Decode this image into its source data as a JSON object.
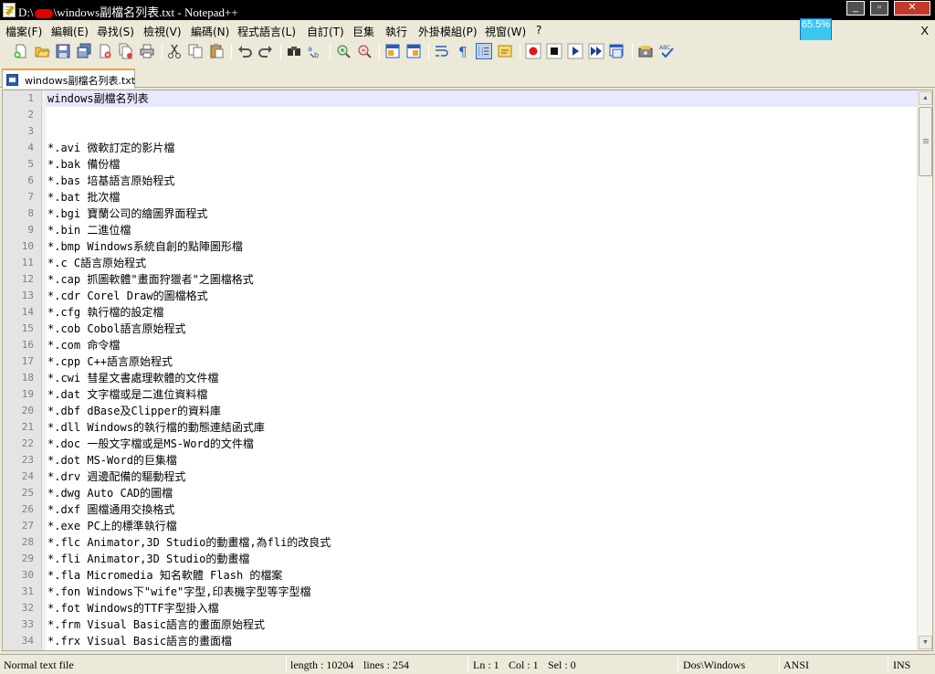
{
  "window": {
    "title_prefix": "D:\\",
    "title_suffix": "\\windows副檔名列表.txt - Notepad++",
    "minimize_glyph": "_",
    "maximize_glyph": "▫",
    "close_glyph": "✕"
  },
  "menu": {
    "items": [
      "檔案(F)",
      "編輯(E)",
      "尋找(S)",
      "檢視(V)",
      "編碼(N)",
      "程式語言(L)",
      "自訂(T)",
      "巨集",
      "執行",
      "外掛模組(P)",
      "視窗(W)",
      "?"
    ],
    "close_label": "X"
  },
  "zoom_indicator": "65.5%",
  "toolbar": {
    "buttons": [
      "new-file",
      "open-file",
      "save",
      "save-all",
      "close",
      "close-all",
      "print",
      "cut",
      "copy",
      "paste",
      "undo",
      "redo",
      "find",
      "replace",
      "zoom-in",
      "zoom-out",
      "sync-vertical",
      "sync-horizontal",
      "word-wrap",
      "show-all-chars",
      "indent-guide",
      "user-defined-lang",
      "record-macro",
      "stop-record",
      "play-macro",
      "run-macro-multiple",
      "save-macro",
      "save-recorded",
      "spell-check"
    ]
  },
  "tab": {
    "label": "windows副檔名列表.txt"
  },
  "editor": {
    "current_line": 1,
    "lines": [
      {
        "n": "1",
        "text": "windows副檔名列表"
      },
      {
        "n": "2",
        "text": ""
      },
      {
        "n": "3",
        "text": ""
      },
      {
        "n": "4",
        "text": "*.avi 微軟訂定的影片檔"
      },
      {
        "n": "5",
        "text": "*.bak 備份檔"
      },
      {
        "n": "6",
        "text": "*.bas 培基語言原始程式"
      },
      {
        "n": "7",
        "text": "*.bat 批次檔"
      },
      {
        "n": "8",
        "text": "*.bgi 寶蘭公司的繪圖界面程式"
      },
      {
        "n": "9",
        "text": "*.bin 二進位檔"
      },
      {
        "n": "10",
        "text": "*.bmp Windows系統自創的點陣圖形檔"
      },
      {
        "n": "11",
        "text": "*.c C語言原始程式"
      },
      {
        "n": "12",
        "text": "*.cap 抓圖軟體\"畫面狩獵者\"之圖檔格式"
      },
      {
        "n": "13",
        "text": "*.cdr Corel Draw的圖檔格式"
      },
      {
        "n": "14",
        "text": "*.cfg 執行檔的設定檔"
      },
      {
        "n": "15",
        "text": "*.cob Cobol語言原始程式"
      },
      {
        "n": "16",
        "text": "*.com 命令檔"
      },
      {
        "n": "17",
        "text": "*.cpp C++語言原始程式"
      },
      {
        "n": "18",
        "text": "*.cwi 彗星文書處理軟體的文件檔"
      },
      {
        "n": "19",
        "text": "*.dat 文字檔或是二進位資料檔"
      },
      {
        "n": "20",
        "text": "*.dbf dBase及Clipper的資料庫"
      },
      {
        "n": "21",
        "text": "*.dll Windows的執行檔的動態連結函式庫"
      },
      {
        "n": "22",
        "text": "*.doc 一般文字檔或是MS-Word的文件檔"
      },
      {
        "n": "23",
        "text": "*.dot MS-Word的巨集檔"
      },
      {
        "n": "24",
        "text": "*.drv 週邊配備的驅動程式"
      },
      {
        "n": "25",
        "text": "*.dwg Auto CAD的圖檔"
      },
      {
        "n": "26",
        "text": "*.dxf 圖檔通用交換格式"
      },
      {
        "n": "27",
        "text": "*.exe PC上的標準執行檔"
      },
      {
        "n": "28",
        "text": "*.flc Animator,3D Studio的動畫檔,為fli的改良式"
      },
      {
        "n": "29",
        "text": "*.fli Animator,3D Studio的動畫檔"
      },
      {
        "n": "30",
        "text": "*.fla Micromedia 知名軟體 Flash 的檔案"
      },
      {
        "n": "31",
        "text": "*.fon Windows下\"wife\"字型,印表機字型等字型檔"
      },
      {
        "n": "32",
        "text": "*.fot Windows的TTF字型掛入檔"
      },
      {
        "n": "33",
        "text": "*.frm Visual Basic語言的畫面原始程式"
      },
      {
        "n": "34",
        "text": "*.frx Visual Basic語言的畫面檔"
      }
    ]
  },
  "status": {
    "file_type": "Normal text file",
    "length": "length : 10204",
    "lines": "lines : 254",
    "ln": "Ln : 1",
    "col": "Col : 1",
    "sel": "Sel : 0",
    "eol": "Dos\\Windows",
    "encoding": "ANSI",
    "mode": "INS"
  },
  "colors": {
    "current_line": "#e8e8ff",
    "tab_accent": "#f4a236",
    "zoom_box": "#3cc7f3"
  }
}
